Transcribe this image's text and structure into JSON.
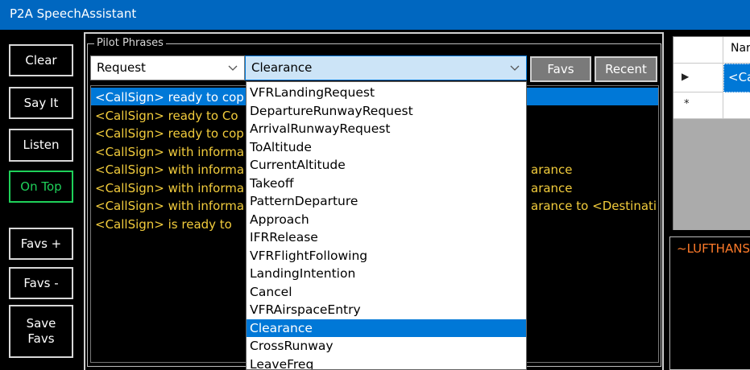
{
  "window": {
    "title": "P2A SpeechAssistant"
  },
  "left_buttons": {
    "clear": "Clear",
    "say_it": "Say It",
    "listen": "Listen",
    "on_top": "On Top",
    "favs_plus": "Favs +",
    "favs_minus": "Favs -",
    "save_favs_line1": "Save",
    "save_favs_line2": "Favs"
  },
  "pilot_phrases": {
    "group_label": "Pilot Phrases",
    "category_combo": "Request",
    "subcategory_combo": "Clearance",
    "favs_button": "Favs",
    "recent_button": "Recent",
    "phrases": [
      "<CallSign> ready to cop",
      "<CallSign> ready to Co",
      "<CallSign> ready to cop",
      "<CallSign> with informa",
      "<CallSign> with informa",
      "<CallSign> with informa",
      "<CallSign> with informa",
      "<CallSign> is  ready to"
    ],
    "phrase_tails": [
      "",
      "",
      "",
      "",
      "arance",
      "arance",
      "arance to <Destinati",
      ""
    ]
  },
  "dropdown": {
    "selected_index": 13,
    "items": [
      "VFRLandingRequest",
      "DepartureRunwayRequest",
      "ArrivalRunwayRequest",
      "ToAltitude",
      "CurrentAltitude",
      "Takeoff",
      "PatternDeparture",
      "Approach",
      "IFRRelease",
      "VFRFlightFollowing",
      "LandingIntention",
      "Cancel",
      "VFRAirspaceEntry",
      "Clearance",
      "CrossRunway",
      "LeaveFreq"
    ]
  },
  "right_grid": {
    "header": "Nar",
    "row1_value": "<Cal",
    "row1_marker": "▶",
    "row2_marker": "*"
  },
  "output": {
    "text": "~LUFTHANS"
  },
  "colors": {
    "titlebar": "#0067c0",
    "selection": "#0078d7",
    "phrase_text": "#f2cc3c",
    "on_top_green": "#1fd15a",
    "output_text": "#ff7b2a"
  }
}
